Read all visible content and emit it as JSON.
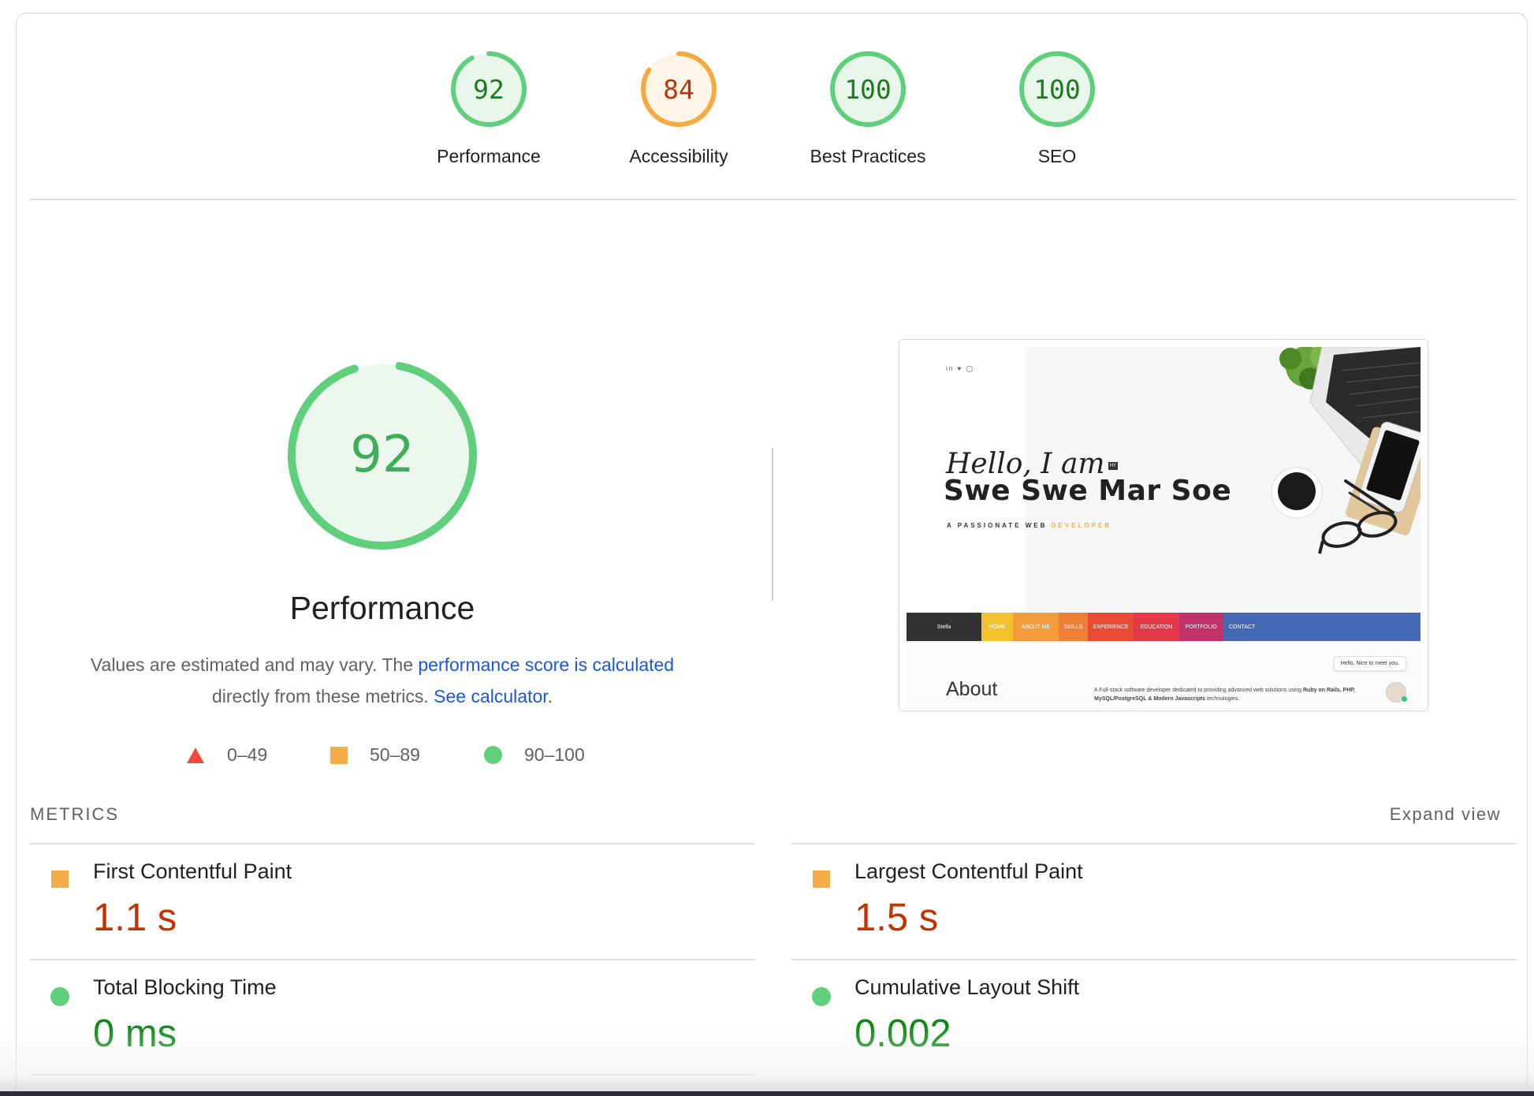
{
  "categories": [
    {
      "score": "92",
      "label": "Performance",
      "rating": "pass",
      "fraction": 0.92
    },
    {
      "score": "84",
      "label": "Accessibility",
      "rating": "average",
      "fraction": 0.84
    },
    {
      "score": "100",
      "label": "Best Practices",
      "rating": "pass",
      "fraction": 1.0
    },
    {
      "score": "100",
      "label": "SEO",
      "rating": "pass",
      "fraction": 1.0
    }
  ],
  "performance": {
    "score": "92",
    "fraction": 0.92,
    "title": "Performance",
    "desc_prefix": "Values are estimated and may vary. The ",
    "desc_link": "performance score is calculated",
    "desc_mid": "directly from these metrics. ",
    "desc_calc_link": "See calculator",
    "desc_end": "."
  },
  "legend": {
    "fail": "0–49",
    "average": "50–89",
    "pass": "90–100"
  },
  "screenshot": {
    "social": "in ♥ ◯",
    "hello": "Hello, I am",
    "hello_tag": "HY",
    "name": "Swe Swe Mar Soe",
    "tagline_a": "A PASSIONATE WEB ",
    "tagline_b": "DEVELOPER",
    "nav": [
      "Stella",
      "HOME",
      "ABOUT ME",
      "SKILLS",
      "EXPERIENCE",
      "EDUCATION",
      "PORTFOLIO",
      "CONTACT"
    ],
    "chip": "Hello, Nice to meet you.",
    "about": "About",
    "about_text_a": "A Full-stack software developer dedicated to providing advanced web solutions using ",
    "about_text_b": "Ruby on Rails, PHP, MySQL/PostgreSQL & Modern Javascripts",
    "about_text_c": " technologies."
  },
  "metrics": {
    "heading": "METRICS",
    "expand": "Expand view",
    "items": [
      {
        "title": "First Contentful Paint",
        "value": "1.1 s",
        "rating": "average"
      },
      {
        "title": "Largest Contentful Paint",
        "value": "1.5 s",
        "rating": "average"
      },
      {
        "title": "Total Blocking Time",
        "value": "0 ms",
        "rating": "pass"
      },
      {
        "title": "Cumulative Layout Shift",
        "value": "0.002",
        "rating": "pass"
      }
    ]
  },
  "colors": {
    "pass": "#0cce6b",
    "pass_text": "#0b8a14",
    "average": "#ffa400",
    "average_text": "#c33300",
    "fail": "#ff4e42",
    "link": "#1a56e5"
  }
}
